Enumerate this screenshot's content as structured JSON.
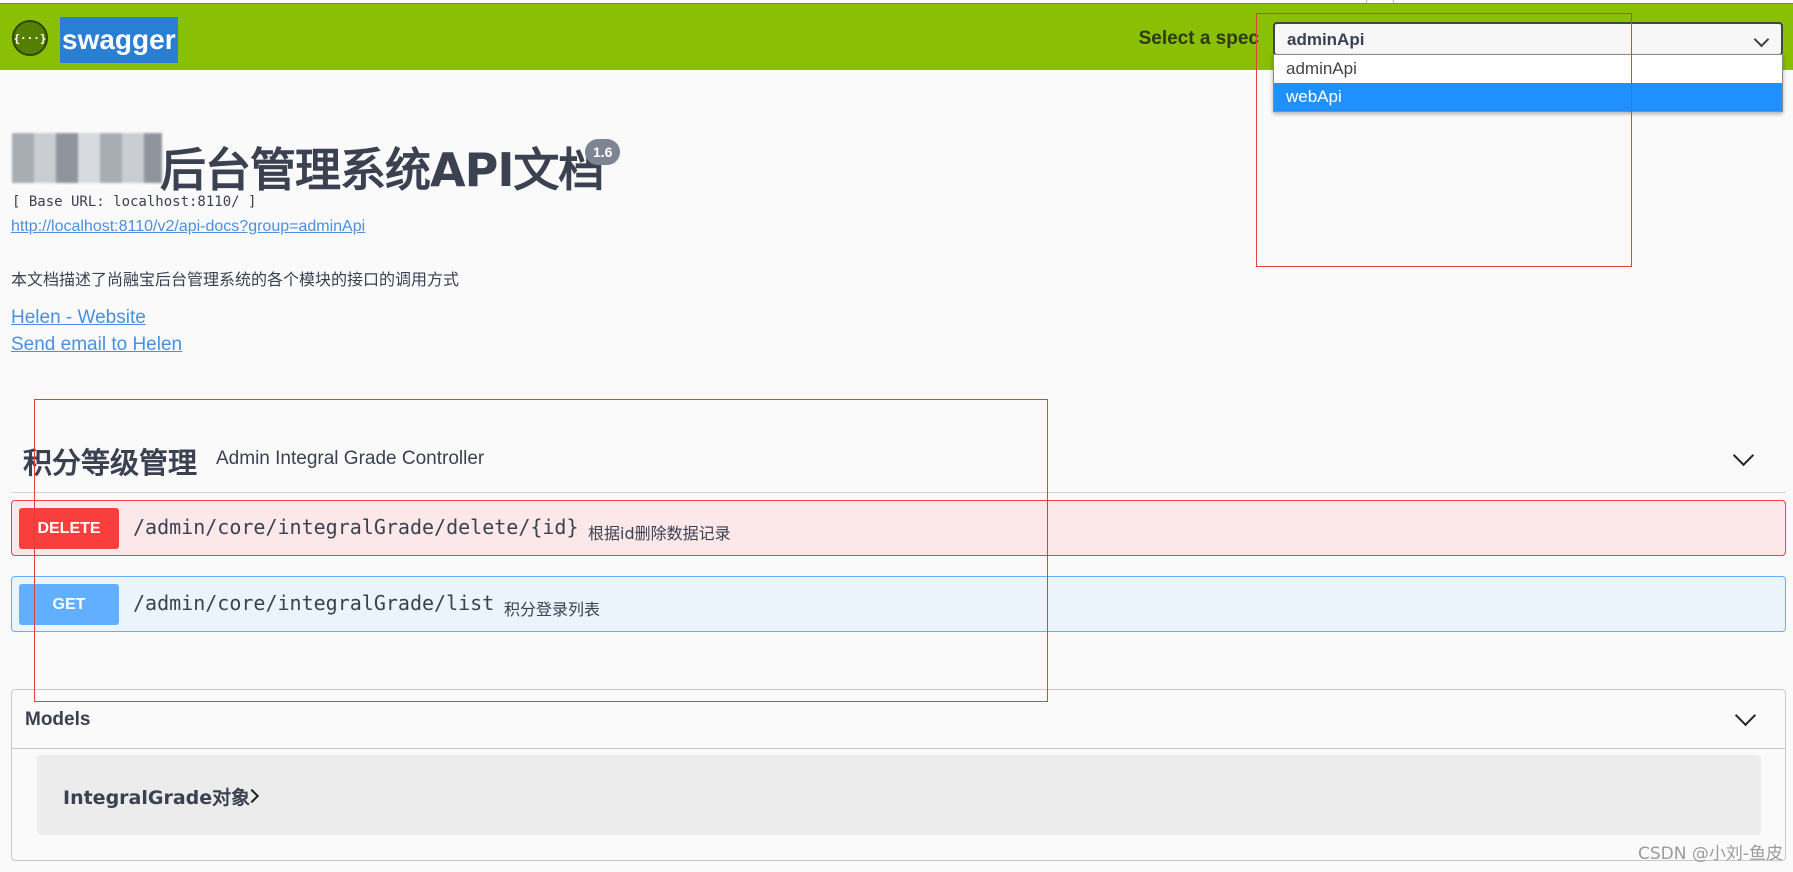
{
  "topbar": {
    "logo_icon": "{···}",
    "logo_text": "swagger",
    "spec_label": "Select a spec",
    "spec_selected": "adminApi",
    "spec_options": [
      "adminApi",
      "webApi"
    ],
    "highlighted_option": "webApi"
  },
  "info": {
    "title": "后台管理系统API文档",
    "version": "1.6",
    "base_url": "[ Base URL: localhost:8110/ ]",
    "api_docs_link": "http://localhost:8110/v2/api-docs?group=adminApi",
    "description": "本文档描述了尚融宝后台管理系统的各个模块的接口的调用方式",
    "contact_website": "Helen - Website",
    "contact_email": "Send email to Helen"
  },
  "tag": {
    "name": "积分等级管理",
    "description": "Admin Integral Grade Controller"
  },
  "operations": [
    {
      "method": "DELETE",
      "path": "/admin/core/integralGrade/delete/{id}",
      "summary": "根据id删除数据记录",
      "color": "#f93e3e"
    },
    {
      "method": "GET",
      "path": "/admin/core/integralGrade/list",
      "summary": "积分登录列表",
      "color": "#61affe"
    }
  ],
  "models": {
    "title": "Models",
    "items": [
      "IntegralGrade对象"
    ]
  },
  "watermark": "CSDN @小刘-鱼皮",
  "colors": {
    "topbar": "#89bf04",
    "delete": "#f93e3e",
    "get": "#61affe",
    "annotation": "#e0413a"
  }
}
